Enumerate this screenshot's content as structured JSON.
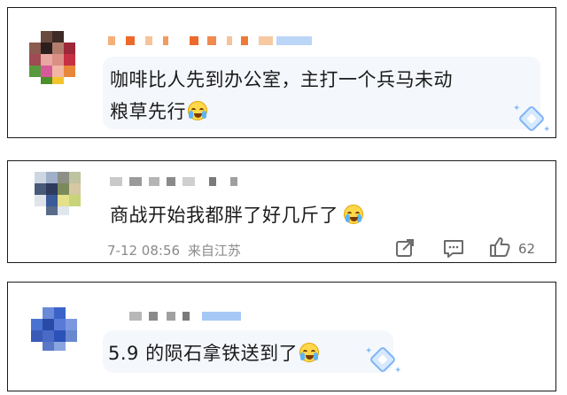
{
  "comments": [
    {
      "text": "咖啡比人先到办公室，主打一个兵马未动",
      "text_line2": "粮草先行",
      "emoji": "crying-laughing-emoji",
      "badge": "diamond-badge"
    },
    {
      "text": "商战开始我都胖了好几斤了",
      "emoji": "crying-face-emoji",
      "timestamp": "7-12 08:56",
      "location": "来自江苏",
      "likes": "62"
    },
    {
      "text": "5.9 的陨石拿铁送到了",
      "emoji": "crying-laughing-emoji",
      "badge": "diamond-badge"
    }
  ],
  "colors": {
    "border": "#1a1a1a",
    "bubble": "#f4f7fc",
    "text": "#1a1a1a",
    "meta": "#8a8a8a",
    "badge_blue": "#7fb4f5"
  },
  "icons": [
    "share-icon",
    "comment-icon",
    "like-icon"
  ]
}
